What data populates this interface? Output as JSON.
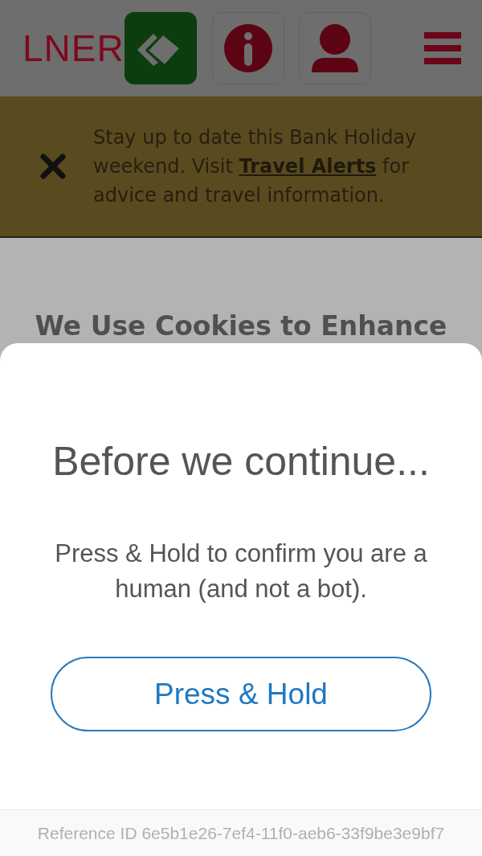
{
  "header": {
    "logo": "LNER"
  },
  "alert": {
    "text_before": "Stay up to date this Bank Holiday weekend. Visit",
    "link": "Travel Alerts",
    "text_after": "for advice and travel information."
  },
  "page": {
    "heading": "We Use Cookies to Enhance"
  },
  "dialog": {
    "title": "Before we continue...",
    "message": "Press & Hold to confirm you are a human (and not a bot).",
    "button": "Press & Hold",
    "reference": "Reference ID 6e5b1e26-7ef4-11f0-aeb6-33f9be3e9bf7"
  }
}
